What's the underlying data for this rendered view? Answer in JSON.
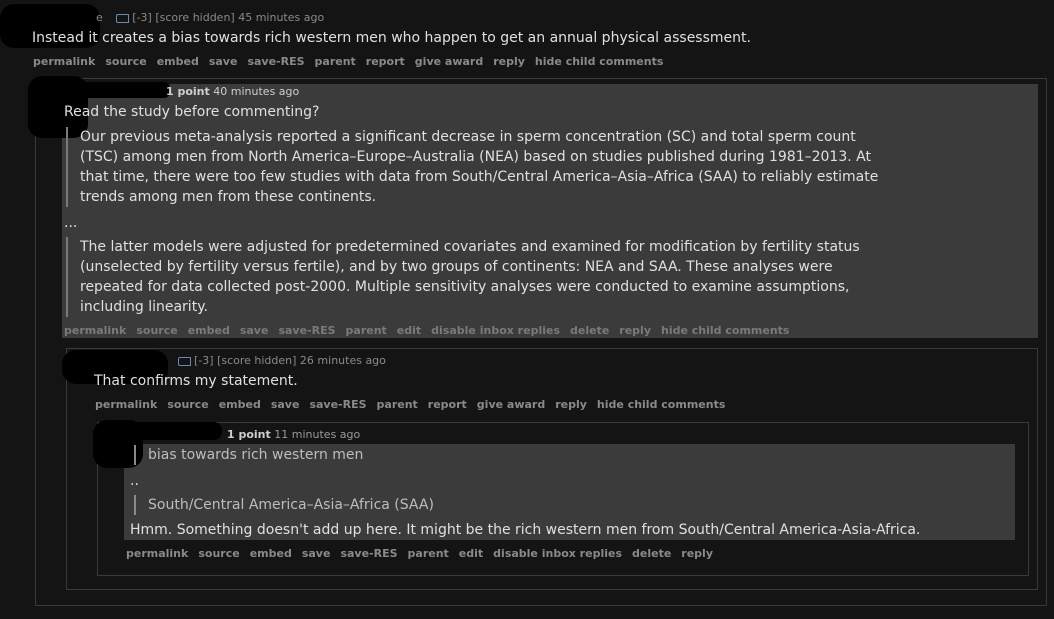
{
  "c1": {
    "name_tail": "e",
    "score": "[-3]",
    "meta": "[score hidden] 45 minutes ago",
    "body": "Instead it creates a bias towards rich western men who happen to get an annual physical assessment.",
    "actions": [
      "permalink",
      "source",
      "embed",
      "save",
      "save-RES",
      "parent",
      "report",
      "give award",
      "reply",
      "hide child comments"
    ]
  },
  "c2": {
    "points": "1 point",
    "meta": "40 minutes ago",
    "intro": "Read the study before commenting?",
    "quote1": [
      "Our previous meta-analysis reported a significant decrease in sperm concentration (SC) and total sperm count",
      "(TSC) among men from North America–Europe–Australia (NEA) based on studies published during 1981–2013. At",
      "that time, there were too few studies with data from South/Central America–Asia–Africa (SAA) to reliably estimate",
      "trends among men from these continents."
    ],
    "ellipsis": "...",
    "quote2": [
      "The latter models were adjusted for predetermined covariates and examined for modification by fertility status",
      "(unselected by fertility versus fertile), and by two groups of continents: NEA and SAA. These analyses were",
      "repeated for data collected post-2000. Multiple sensitivity analyses were conducted to examine assumptions,",
      "including linearity."
    ],
    "actions": [
      "permalink",
      "source",
      "embed",
      "save",
      "save-RES",
      "parent",
      "edit",
      "disable inbox replies",
      "delete",
      "reply",
      "hide child comments"
    ]
  },
  "c3": {
    "score": "[-3]",
    "meta": "[score hidden] 26 minutes ago",
    "body": "That confirms my statement.",
    "actions": [
      "permalink",
      "source",
      "embed",
      "save",
      "save-RES",
      "parent",
      "report",
      "give award",
      "reply",
      "hide child comments"
    ]
  },
  "c4": {
    "points": "1 point",
    "meta": "11 minutes ago",
    "quote1": "bias towards rich western men",
    "ellipsis": "..",
    "quote2": "South/Central America–Asia–Africa (SAA)",
    "body": "Hmm. Something doesn't add up here. It might be the rich western men from South/Central America-Asia-Africa.",
    "actions": [
      "permalink",
      "source",
      "embed",
      "save",
      "save-RES",
      "parent",
      "edit",
      "disable inbox replies",
      "delete",
      "reply"
    ]
  },
  "colors": {
    "self_highlight": "#3b3b3b",
    "tag_icon": "#6a8ab5"
  },
  "icons": [
    "tag-icon"
  ]
}
